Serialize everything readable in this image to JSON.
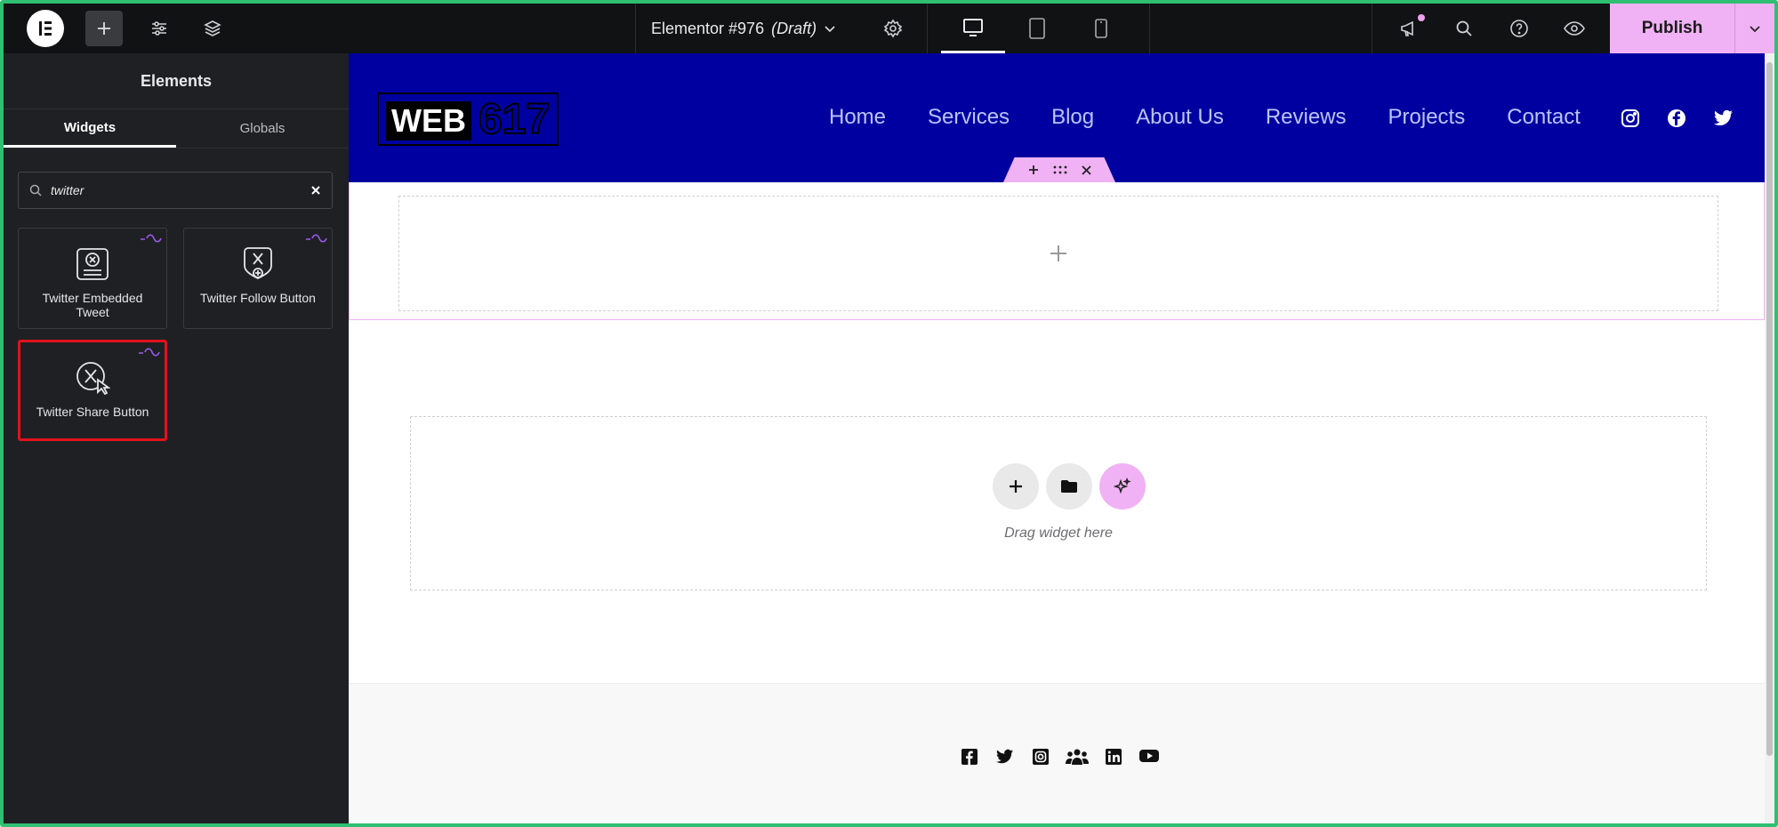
{
  "topbar": {
    "document_title": "Elementor #976",
    "document_status": "(Draft)",
    "publish_label": "Publish"
  },
  "panel": {
    "title": "Elements",
    "tabs": [
      "Widgets",
      "Globals"
    ],
    "search": {
      "value": "twitter"
    },
    "widgets": [
      {
        "label": "Twitter Embedded Tweet",
        "icon": "tweet-card-icon"
      },
      {
        "label": "Twitter Follow Button",
        "icon": "x-follow-icon"
      },
      {
        "label": "Twitter Share Button",
        "icon": "x-share-icon"
      }
    ]
  },
  "site": {
    "logo_text": "WEB",
    "logo_number": "617",
    "nav": [
      "Home",
      "Services",
      "Blog",
      "About Us",
      "Reviews",
      "Projects",
      "Contact"
    ],
    "social_top": [
      "instagram-icon",
      "facebook-icon",
      "twitter-icon"
    ],
    "drop_zone_text": "Drag widget here",
    "footer_social": [
      "facebook-icon",
      "twitter-icon",
      "instagram-icon",
      "group-icon",
      "linkedin-icon",
      "youtube-icon"
    ]
  },
  "colors": {
    "header_bg": "#0000a0",
    "accent_pink": "#f0b2f4",
    "panel_bg": "#1f2024",
    "selection_red": "#e2121b"
  }
}
